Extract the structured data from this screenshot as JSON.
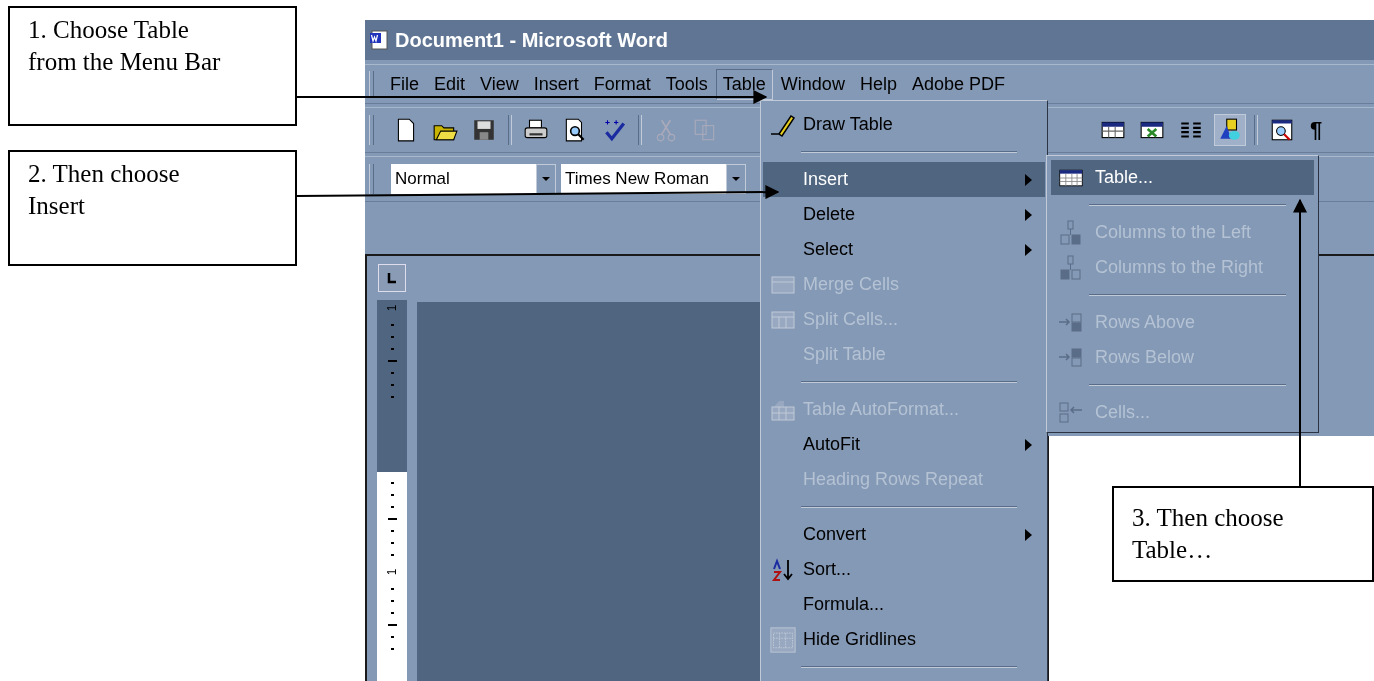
{
  "window": {
    "title": "Document1 - Microsoft Word"
  },
  "menu_bar": [
    {
      "label": "File",
      "selected": false
    },
    {
      "label": "Edit",
      "selected": false
    },
    {
      "label": "View",
      "selected": false
    },
    {
      "label": "Insert",
      "selected": false
    },
    {
      "label": "Format",
      "selected": false
    },
    {
      "label": "Tools",
      "selected": false
    },
    {
      "label": "Table",
      "selected": true
    },
    {
      "label": "Window",
      "selected": false
    },
    {
      "label": "Help",
      "selected": false
    },
    {
      "label": "Adobe PDF",
      "selected": false
    }
  ],
  "standard_toolbar": {
    "drawing_on": true,
    "pilcrow": "¶"
  },
  "formatting_toolbar": {
    "style": "Normal",
    "font": "Times New Roman"
  },
  "ruler": {
    "labels": [
      "1",
      "1"
    ]
  },
  "table_menu": [
    {
      "kind": "item",
      "label": "Draw Table",
      "disabled": false,
      "submenu": false,
      "selected": false
    },
    {
      "kind": "separator"
    },
    {
      "kind": "item",
      "label": "Insert",
      "disabled": false,
      "submenu": true,
      "selected": true
    },
    {
      "kind": "item",
      "label": "Delete",
      "disabled": false,
      "submenu": true,
      "selected": false
    },
    {
      "kind": "item",
      "label": "Select",
      "disabled": false,
      "submenu": true,
      "selected": false
    },
    {
      "kind": "item",
      "label": "Merge Cells",
      "disabled": true,
      "submenu": false,
      "selected": false
    },
    {
      "kind": "item",
      "label": "Split Cells...",
      "disabled": true,
      "submenu": false,
      "selected": false
    },
    {
      "kind": "item",
      "label": "Split Table",
      "disabled": true,
      "submenu": false,
      "selected": false
    },
    {
      "kind": "separator"
    },
    {
      "kind": "item",
      "label": "Table AutoFormat...",
      "disabled": true,
      "submenu": false,
      "selected": false
    },
    {
      "kind": "item",
      "label": "AutoFit",
      "disabled": false,
      "submenu": true,
      "selected": false
    },
    {
      "kind": "item",
      "label": "Heading Rows Repeat",
      "disabled": true,
      "submenu": false,
      "selected": false
    },
    {
      "kind": "separator"
    },
    {
      "kind": "item",
      "label": "Convert",
      "disabled": false,
      "submenu": true,
      "selected": false
    },
    {
      "kind": "item",
      "label": "Sort...",
      "disabled": false,
      "submenu": false,
      "selected": false
    },
    {
      "kind": "item",
      "label": "Formula...",
      "disabled": false,
      "submenu": false,
      "selected": false
    },
    {
      "kind": "item",
      "label": "Hide Gridlines",
      "disabled": false,
      "submenu": false,
      "selected": false
    },
    {
      "kind": "separator"
    }
  ],
  "insert_submenu": [
    {
      "kind": "item",
      "label": "Table...",
      "disabled": false,
      "selected": true
    },
    {
      "kind": "separator"
    },
    {
      "kind": "item",
      "label": "Columns to the Left",
      "disabled": true,
      "selected": false
    },
    {
      "kind": "item",
      "label": "Columns to the Right",
      "disabled": true,
      "selected": false
    },
    {
      "kind": "separator"
    },
    {
      "kind": "item",
      "label": "Rows Above",
      "disabled": true,
      "selected": false
    },
    {
      "kind": "item",
      "label": "Rows Below",
      "disabled": true,
      "selected": false
    },
    {
      "kind": "separator"
    },
    {
      "kind": "item",
      "label": "Cells...",
      "disabled": true,
      "selected": false
    }
  ],
  "callouts": [
    {
      "lines": [
        "1. Choose Table",
        "from the Menu Bar"
      ]
    },
    {
      "lines": [
        "2. Then choose",
        "Insert"
      ]
    },
    {
      "lines": [
        "3. Then choose",
        "Table…"
      ]
    }
  ]
}
